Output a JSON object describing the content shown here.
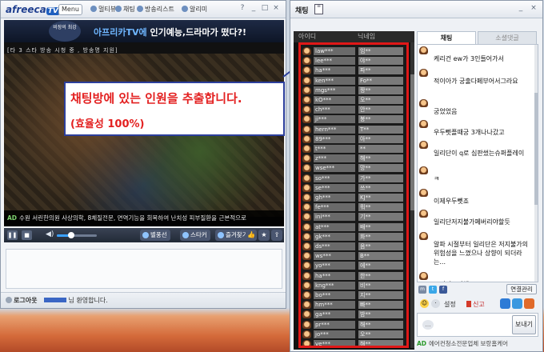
{
  "player": {
    "logo_text": "afreeca",
    "logo_tv": "TV",
    "menu_label": "Menu",
    "nav": [
      "멀티뷰",
      "채팅",
      "방송리스트",
      "알리미"
    ],
    "window_controls": [
      "?",
      "_",
      "□",
      "×"
    ],
    "banner": {
      "emblem": "비장의 최강",
      "text_prefix": "아프리카TV에",
      "text_rest": " 인기예능,드라마가 떴다?!"
    },
    "video_subtitle": "[타 3 스타 방송 시청 중 , 방송명 지원]",
    "ticker": {
      "ad": "AD",
      "text": "수원 서린한의원 사상의학, 8체질전문, 면역기능을 회복하여 난치성 피부질환을 근본적으로"
    },
    "controls": {
      "play": "❚❚",
      "stop": "■",
      "volume_icon": "◀)",
      "volume_level": 0.35,
      "btn_quality": "별풍선",
      "btn_star": "스타커",
      "btn_record": "즐겨찾기",
      "like": "👍",
      "fav": "★",
      "share": "⇪"
    },
    "status": {
      "logout": "로그아웃",
      "welcome": "님 환영합니다."
    }
  },
  "annotation": {
    "line1": "채팅방에 있는 인원을 추출합니다.",
    "line2": "(효율성 100%)"
  },
  "chat": {
    "title": "채팅",
    "doc_icon": "≡",
    "window_controls": [
      "_",
      "×"
    ],
    "userlist": {
      "header_id": "아이디",
      "header_nick": "닉네임",
      "users": [
        {
          "id": "law***",
          "nick": "임**"
        },
        {
          "id": "lee***",
          "nick": "야**"
        },
        {
          "id": "ha***",
          "nick": "파**"
        },
        {
          "id": "ken***",
          "nick": "Fo**"
        },
        {
          "id": "mgs***",
          "nick": "짱**"
        },
        {
          "id": "kO***",
          "nick": "오**"
        },
        {
          "id": "ch***",
          "nick": "안**"
        },
        {
          "id": "ji***",
          "nick": "봉**"
        },
        {
          "id": "hern***",
          "nick": "T**"
        },
        {
          "id": "89***",
          "nick": "아**"
        },
        {
          "id": "t***",
          "nick": "**"
        },
        {
          "id": "z***",
          "nick": "해**"
        },
        {
          "id": "wse***",
          "nick": "망**"
        },
        {
          "id": "so***",
          "nick": "가**"
        },
        {
          "id": "se***",
          "nick": "쓰**"
        },
        {
          "id": "gh***",
          "nick": "KJ**"
        },
        {
          "id": "fe***",
          "nick": "뭐**"
        },
        {
          "id": "ini***",
          "nick": "기**"
        },
        {
          "id": "at***",
          "nick": "배**"
        },
        {
          "id": "gk***",
          "nick": "화**"
        },
        {
          "id": "ds***",
          "nick": "음**"
        },
        {
          "id": "ws***",
          "nick": "B**"
        },
        {
          "id": "yo***",
          "nick": "에**"
        },
        {
          "id": "ha***",
          "nick": "한**"
        },
        {
          "id": "kng***",
          "nick": "비**"
        },
        {
          "id": "bo***",
          "nick": "지**"
        },
        {
          "id": "hm***",
          "nick": "빠**"
        },
        {
          "id": "ga***",
          "nick": "밤**"
        },
        {
          "id": "pr***",
          "nick": "해**"
        },
        {
          "id": "jo***",
          "nick": "오**"
        },
        {
          "id": "ve***",
          "nick": "해**"
        }
      ]
    },
    "tabs": [
      {
        "label": "채팅",
        "active": true
      },
      {
        "label": "소셜댓글",
        "active": false
      }
    ],
    "messages": [
      "케리건 ew가 3인들어가서",
      "적이아가 궁출다페부어서그라요",
      "궁었었음",
      "우두뻿플때궁 3개나나갔고",
      "일리단이 q로 심판썼는슈퍼플레이",
      "ㅋ",
      "이제우두뻿죠",
      "일리단저지불가페버리야할듯",
      "알파 시절부터 일리단은 저지불가의 위험성을 느꼈으나 상향이 되더라는...",
      "그거너프만해도"
    ],
    "social": {
      "connect_label": "연결관리"
    },
    "options": {
      "settings": "설정",
      "report": "신고"
    },
    "input": {
      "send_label": "보내기",
      "bubble": "…"
    },
    "ad": {
      "badge": "AD",
      "text": "에어컨청소전문업체 보랑홈케어"
    }
  },
  "colors": {
    "annotation_red": "#e32020",
    "annotation_border": "#2c3f9c",
    "highlight_box": "#e01818"
  }
}
